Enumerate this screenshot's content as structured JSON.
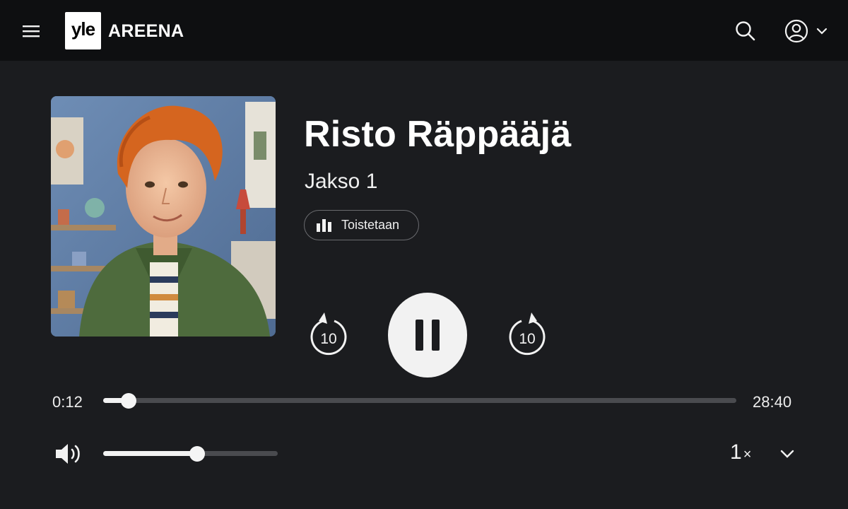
{
  "header": {
    "logo_mark": "yle",
    "logo_text": "AREENA",
    "menu_icon": "hamburger-menu-icon",
    "search_icon": "search-icon",
    "user_icon": "user-account-icon"
  },
  "episode": {
    "title": "Risto Räppääjä",
    "subtitle": "Jakso 1",
    "status": "Toistetaan"
  },
  "controls": {
    "rewind_label": "10",
    "forward_label": "10",
    "pause_icon": "pause-icon"
  },
  "progress": {
    "current": "0:12",
    "total": "28:40",
    "fraction": 0.04
  },
  "volume": {
    "level": 0.54
  },
  "speed": {
    "value": "1",
    "suffix": "×"
  },
  "colors": {
    "background": "#1b1c1f",
    "topbar": "#0e0f11",
    "accent": "#f2f2f2",
    "track": "#4a4b4f"
  }
}
